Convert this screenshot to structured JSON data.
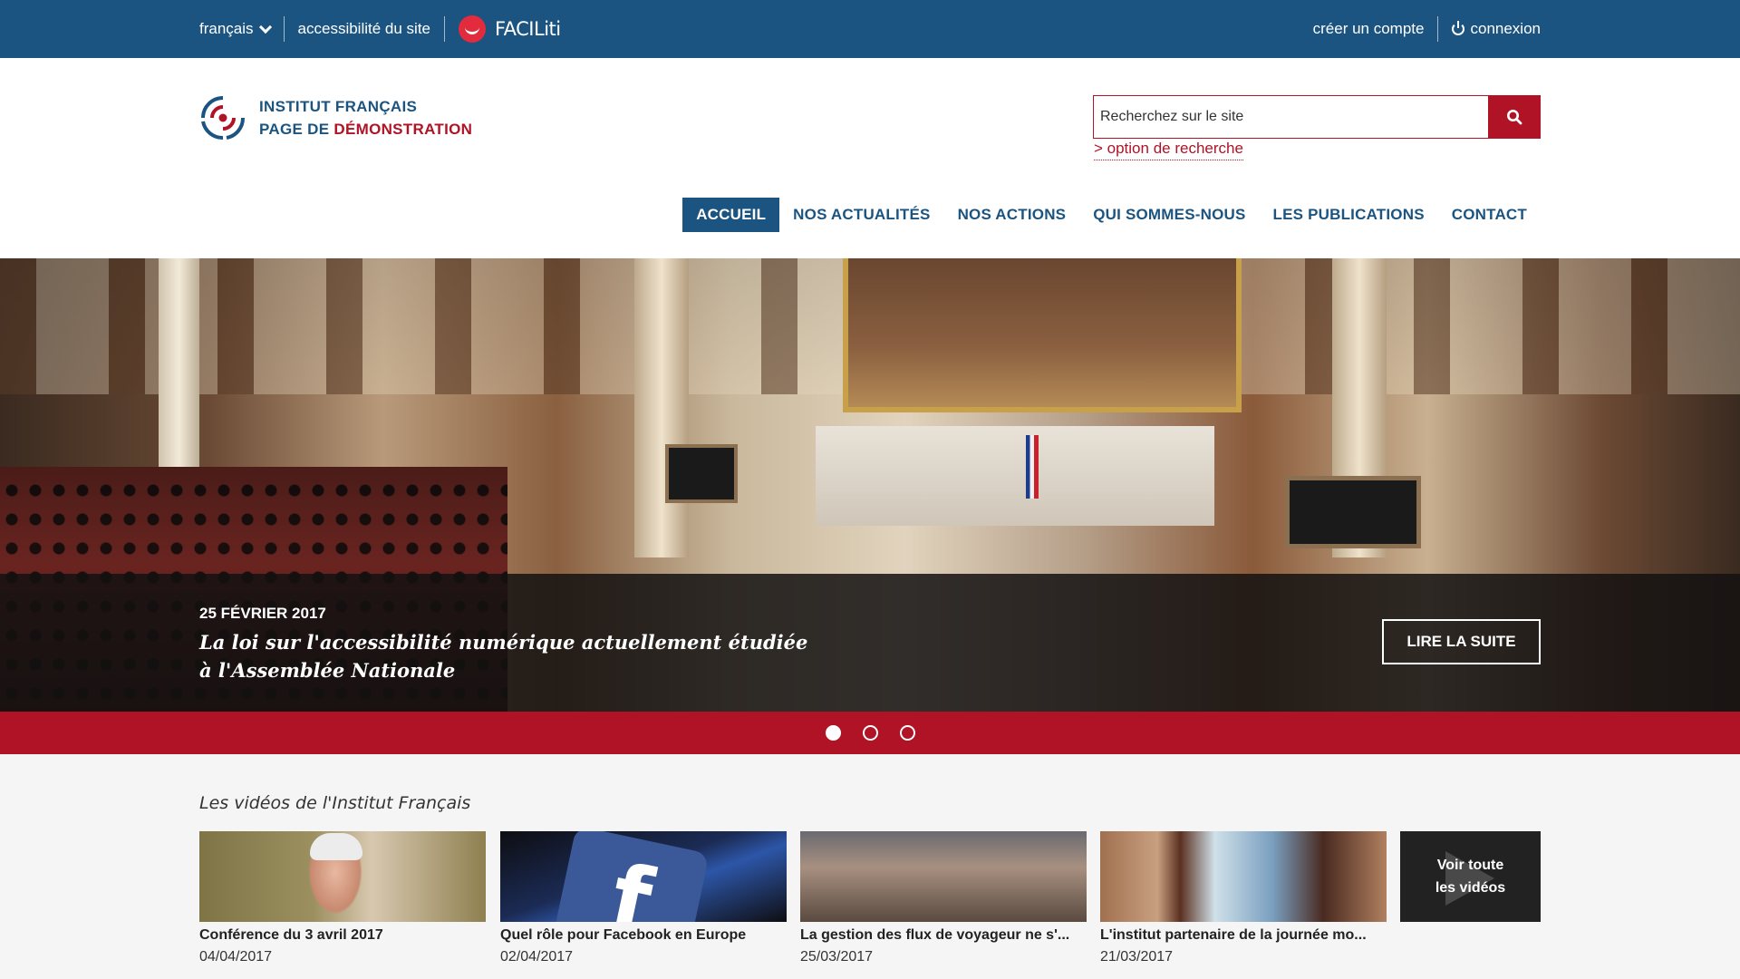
{
  "topbar": {
    "language_label": "français",
    "accessibility_label": "accessibilité du site",
    "faciliti_label": "FACILiti",
    "create_account_label": "créer un compte",
    "login_label": "connexion"
  },
  "header": {
    "logo_line1": "INSTITUT FRANÇAIS",
    "logo_line2_prefix": "PAGE DE ",
    "logo_line2_accent": "DÉMONSTRATION",
    "search_placeholder": "Recherchez sur le site",
    "search_option": "> option de recherche"
  },
  "nav": {
    "items": [
      {
        "label": "ACCUEIL",
        "active": true
      },
      {
        "label": "NOS ACTUALITÉS"
      },
      {
        "label": "NOS ACTIONS"
      },
      {
        "label": "QUI SOMMES-NOUS"
      },
      {
        "label": "LES PUBLICATIONS"
      },
      {
        "label": "CONTACT"
      }
    ]
  },
  "hero": {
    "date": "25 FÉVRIER 2017",
    "title": "La loi sur l'accessibilité numérique actuellement étudiée à l'Assemblée Nationale",
    "button_label": "LIRE LA SUITE",
    "slide_count": 3,
    "active_slide": 1
  },
  "videos": {
    "heading": "Les vidéos de l'Institut Français",
    "items": [
      {
        "title": "Conférence du 3 avril 2017",
        "date": "04/04/2017"
      },
      {
        "title": "Quel rôle pour Facebook en Europe",
        "date": "02/04/2017"
      },
      {
        "title": "La gestion des flux de voyageur ne s'...",
        "date": "25/03/2017"
      },
      {
        "title": "L'institut partenaire de la journée mo...",
        "date": "21/03/2017"
      }
    ],
    "see_all_line1": "Voir toute",
    "see_all_line2": "les vidéos"
  },
  "colors": {
    "brand_blue": "#1b5480",
    "brand_red": "#b01326"
  }
}
